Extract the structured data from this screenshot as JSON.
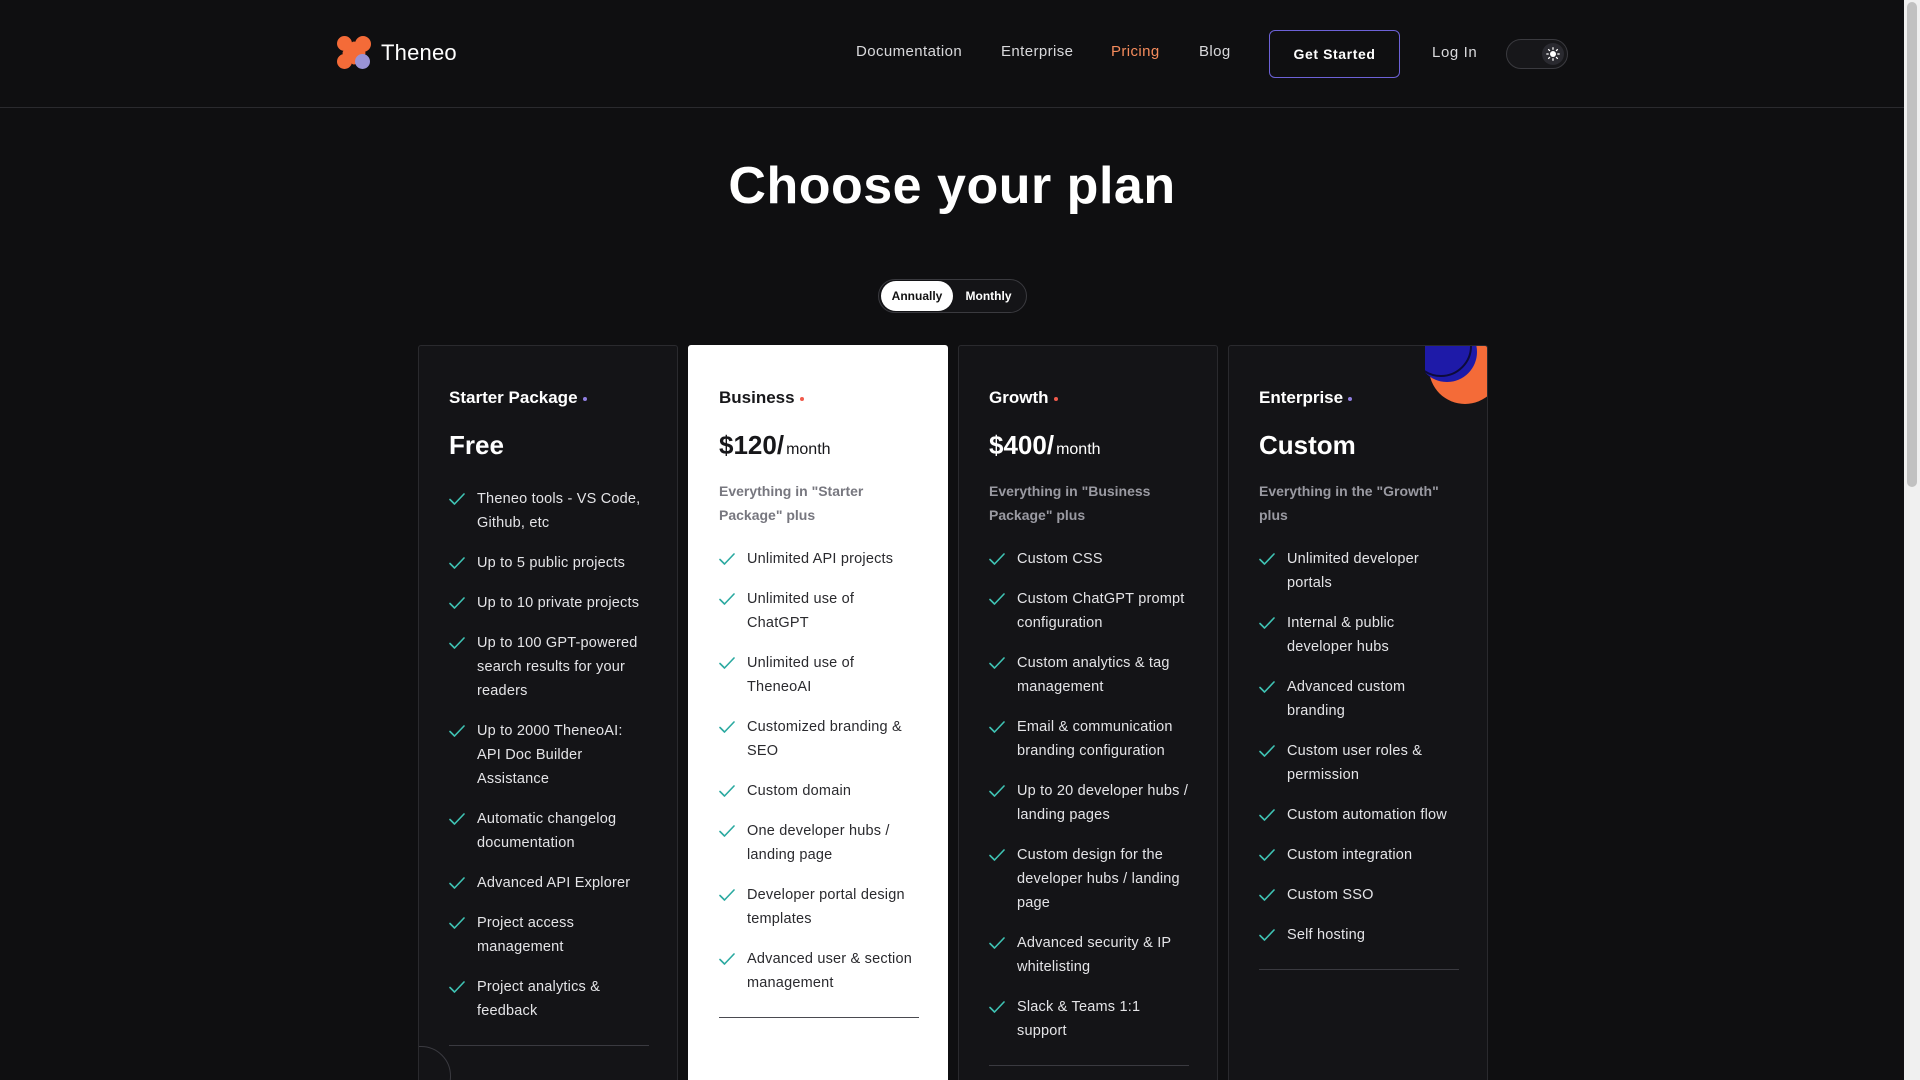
{
  "brand": {
    "name": "Theneo"
  },
  "nav": {
    "items": [
      {
        "label": "Documentation",
        "active": false
      },
      {
        "label": "Enterprise",
        "active": false
      },
      {
        "label": "Pricing",
        "active": true
      },
      {
        "label": "Blog",
        "active": false
      }
    ],
    "get_started_label": "Get Started",
    "login_label": "Log In",
    "theme_toggle_icon": "sun-icon"
  },
  "hero": {
    "title": "Choose your plan"
  },
  "billing": {
    "options": [
      "Annually",
      "Monthly"
    ],
    "selected": "Annually"
  },
  "colors": {
    "accent_orange": "#f58b5c",
    "accent_purple": "#6d62d8",
    "dot_red": "#f05a4b",
    "dot_purple": "#8f7ee0"
  },
  "plans": [
    {
      "name": "Starter Package",
      "dot_color": "#8f7ee0",
      "price": "Free",
      "per": "",
      "description": "",
      "features": [
        "Theneo tools - VS Code, Github, etc",
        "Up to 5 public projects",
        "Up to 10 private projects",
        "Up to 100 GPT-powered search results for your readers",
        "Up to 2000 TheneoAI: API Doc Builder Assistance",
        "Automatic changelog documentation",
        "Advanced API Explorer",
        "Project access management",
        "Project analytics & feedback"
      ]
    },
    {
      "name": "Business",
      "dot_color": "#f05a4b",
      "price": "$120/",
      "per": "month",
      "description": "Everything in \"Starter Package\" plus",
      "features": [
        "Unlimited API projects",
        "Unlimited use of ChatGPT",
        "Unlimited use of TheneoAI",
        "Customized branding & SEO",
        "Custom domain",
        "One developer hubs / landing page",
        "Developer portal design templates",
        "Advanced user & section management"
      ]
    },
    {
      "name": "Growth",
      "dot_color": "#f05a4b",
      "price": "$400/",
      "per": "month",
      "description": "Everything in \"Business Package\" plus",
      "features": [
        "Custom CSS",
        "Custom ChatGPT prompt configuration",
        "Custom analytics & tag management",
        "Email & communication branding configuration",
        "Up to 20 developer hubs / landing pages",
        "Custom design for the developer hubs / landing page",
        "Advanced security & IP whitelisting",
        "Slack & Teams 1:1 support"
      ]
    },
    {
      "name": "Enterprise",
      "dot_color": "#8f7ee0",
      "price": "Custom",
      "per": "",
      "description": "Everything in the \"Growth\" plus",
      "features": [
        "Unlimited developer portals",
        "Internal & public developer hubs",
        "Advanced custom branding",
        "Custom user roles & permission",
        "Custom automation flow",
        "Custom integration",
        "Custom SSO",
        "Self hosting"
      ]
    }
  ]
}
